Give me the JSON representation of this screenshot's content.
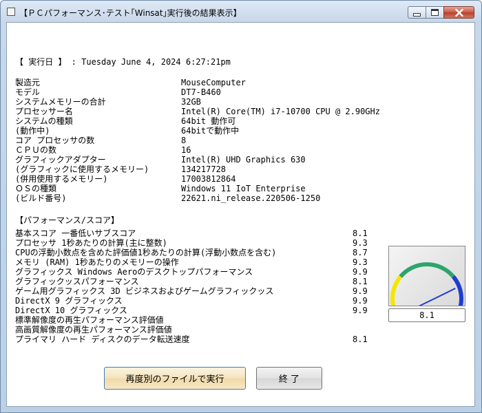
{
  "window": {
    "title": "【ＰＣパフォーマンス･テスト｢Winsat｣実行後の結果表示】"
  },
  "run_date": {
    "text": "【 実行日 】 : Tuesday June 4, 2024  6:27:21pm"
  },
  "system_info": [
    {
      "label": "製造元",
      "value": "MouseComputer"
    },
    {
      "label": "モデル",
      "value": "DT7-B460"
    },
    {
      "label": "システムメモリーの合計",
      "value": "32GB"
    },
    {
      "label": "プロセッサー名",
      "value": "Intel(R) Core(TM) i7-10700 CPU @ 2.90GHz"
    },
    {
      "label": "システムの種類",
      "value": "64bit 動作可"
    },
    {
      "label": "       (動作中)",
      "value": "64bitで動作中"
    },
    {
      "label": "コア プロセッサの数",
      "value": "8"
    },
    {
      "label": "ＣＰＵの数",
      "value": "16"
    },
    {
      "label": "グラフィックアダプター",
      "value": "Intel(R) UHD Graphics 630"
    },
    {
      "label": " (グラフィックに使用するメモリー)",
      "value": "134217728"
    },
    {
      "label": " (併用使用するメモリー)",
      "value": "17003812864"
    },
    {
      "label": "ＯＳの種類",
      "value": "Windows 11 IoT Enterprise"
    },
    {
      "label": "        (ビルド番号)",
      "value": "22621.ni_release.220506-1250"
    }
  ],
  "scores_header": "【パフォーマンス/スコア】",
  "scores": [
    {
      "label": "基本スコア  一番低いサブスコア",
      "value": "8.1"
    },
    {
      "label": "プロセッサ    1秒あたりの計算(主に整数)",
      "value": "9.3"
    },
    {
      "label": "CPUの浮動小数点を含めた評価値1秒あたりの計算(浮動小数点を含む)",
      "value": "8.7"
    },
    {
      "label": "メモリ (RAM)    1秒あたりのメモリーの操作",
      "value": "9.3"
    },
    {
      "label": "グラフィックス   Windows Aeroのデスクトップパフォーマンス",
      "value": "9.9"
    },
    {
      "label": "グラフィックッスパフォーマンス",
      "value": "8.1"
    },
    {
      "label": "ゲーム用グラフィックス  3D ビジネスおよびゲームグラフィックッス",
      "value": "9.9"
    },
    {
      "label": "DirectX 9 グラフィックス",
      "value": "9.9"
    },
    {
      "label": "DirectX 10 グラフィックス",
      "value": "9.9"
    },
    {
      "label": "標準解像度の再生パフォーマンス評価値",
      "value": ""
    },
    {
      "label": "高画質解像度の再生パフォーマンス評価値",
      "value": ""
    },
    {
      "label": "プライマリ ハード ディスクのデータ転送速度",
      "value": "8.1"
    }
  ],
  "gauge": {
    "value": "8.1",
    "level": 8.1,
    "max": 9.9,
    "colors": {
      "low": "#f3e600",
      "mid": "#2da56a",
      "high": "#1e3ccf",
      "needle": "#1f3fd8"
    }
  },
  "buttons": {
    "rerun": "再度別のファイルで実行",
    "exit": "終  了"
  }
}
